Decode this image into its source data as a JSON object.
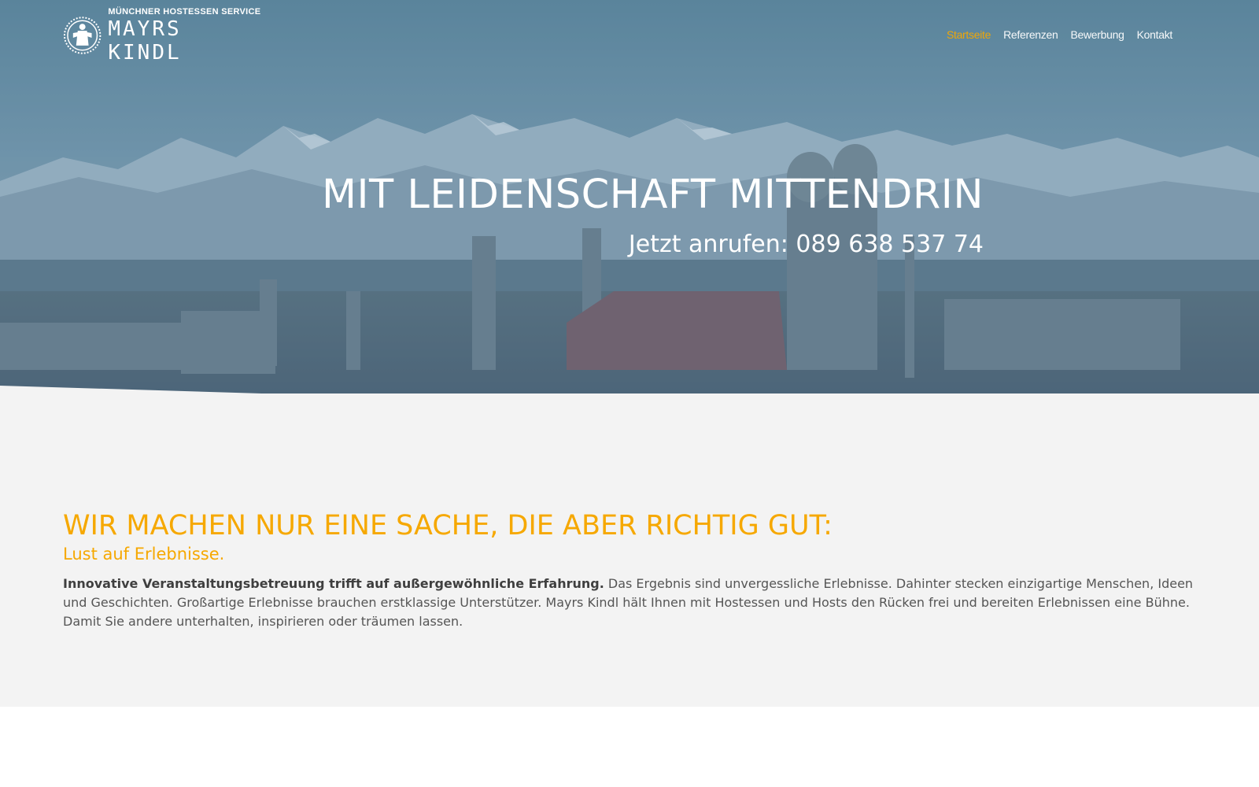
{
  "brand": {
    "tagline": "MÜNCHNER HOSTESSEN SERVICE",
    "name": "MAYRS KINDL",
    "accent_color": "#f6a800"
  },
  "nav": {
    "items": [
      {
        "label": "Startseite",
        "active": true
      },
      {
        "label": "Referenzen",
        "active": false
      },
      {
        "label": "Bewerbung",
        "active": false
      },
      {
        "label": "Kontakt",
        "active": false
      }
    ]
  },
  "hero": {
    "title": "MIT LEIDENSCHAFT MITTENDRIN",
    "phone_line": "Jetzt anrufen: 089 638 537 74",
    "background": "munich-skyline-alps-image"
  },
  "intro": {
    "heading": "WIR MACHEN NUR EINE SACHE, DIE ABER RICHTIG GUT:",
    "subheading": "Lust auf Erlebnisse.",
    "lead_bold": "Innovative Veranstaltungsbetreuung trifft auf außergewöhnliche Erfahrung.",
    "body": " Das Ergebnis sind unvergessliche Erlebnisse. Dahinter stecken einzigartige Menschen, Ideen und Geschichten. Großartige Erlebnisse brauchen erstklassige Unterstützer. Mayrs Kindl hält Ihnen mit Hostessen und Hosts den Rücken frei und bereiten Erlebnissen eine Bühne. Damit Sie andere unterhalten, inspirieren oder träumen lassen."
  }
}
